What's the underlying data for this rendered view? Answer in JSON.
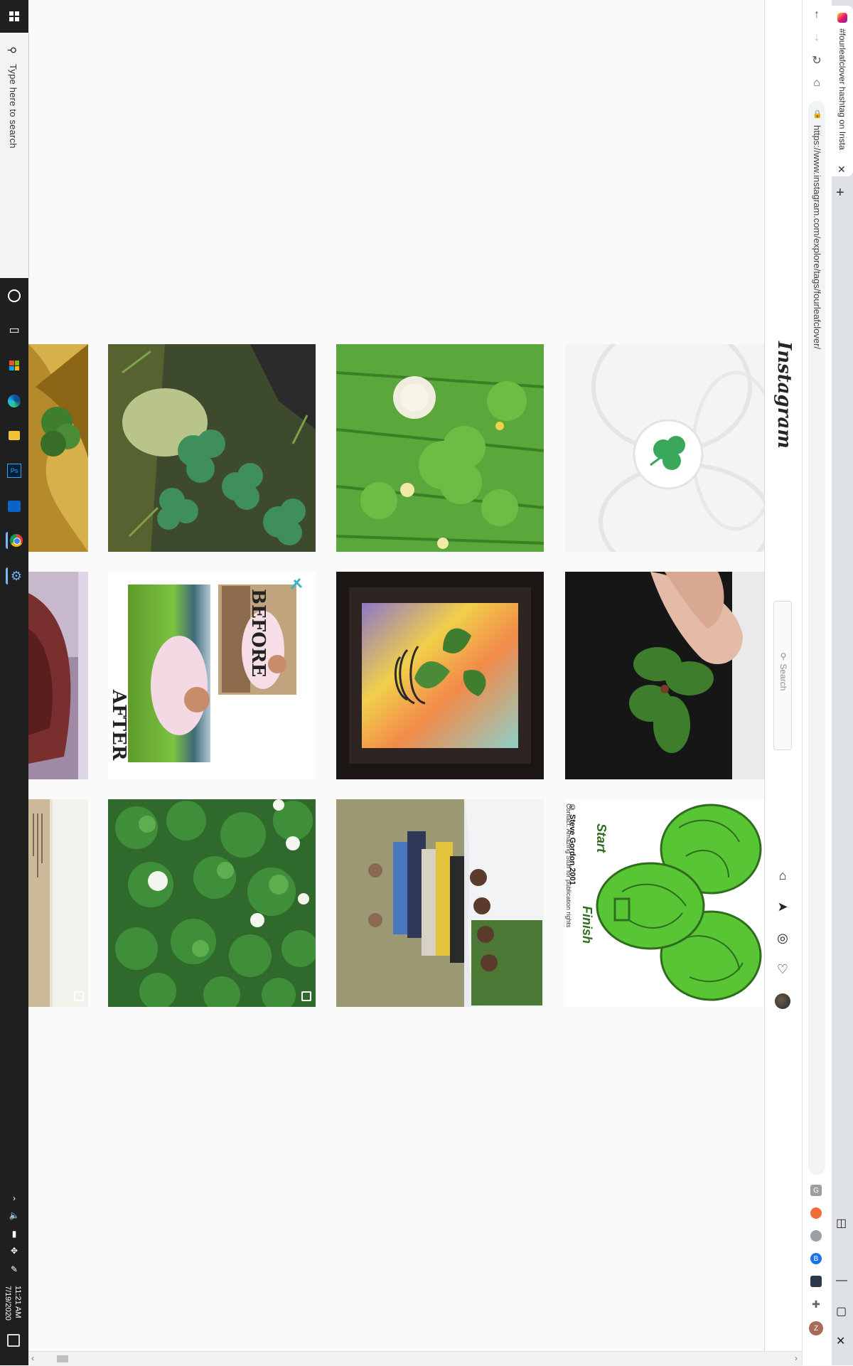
{
  "taskbar": {
    "search_placeholder": "Type here to search",
    "clock_time": "11:21 AM",
    "clock_date": "7/19/2020",
    "apps": [
      "cortana-icon",
      "task-view-icon",
      "microsoft-store-icon",
      "edge-icon",
      "file-explorer-icon",
      "photoshop-icon",
      "outlook-icon",
      "chrome-icon",
      "settings-icon"
    ]
  },
  "browser": {
    "tab_title": "#fourleafclover hashtag on Insta",
    "url": "https://www.instagram.com/explore/tags/fourleafclover/",
    "extensions": [
      "G",
      "",
      "",
      "B",
      "",
      "",
      "Z"
    ]
  },
  "instagram": {
    "logo": "Instagram",
    "search_placeholder": "Search"
  },
  "posts": [
    {
      "id": "p1",
      "caption_top": "",
      "caption_bottom": ""
    },
    {
      "id": "p2",
      "caption_top": "BEFORE",
      "caption_bottom": "AFTER"
    },
    {
      "id": "p3",
      "maze_copyright": "© Steve Gordon 2001",
      "maze_contact": "Contact: Amazing Stuff for publication rights",
      "maze_start": "Start",
      "maze_finish": "Finish"
    }
  ],
  "colors": {
    "taskbar": "#1f1f1f",
    "clover_green": "#3f8f3a",
    "maze_green": "#58c634",
    "ig_border": "#dbdbdb"
  }
}
